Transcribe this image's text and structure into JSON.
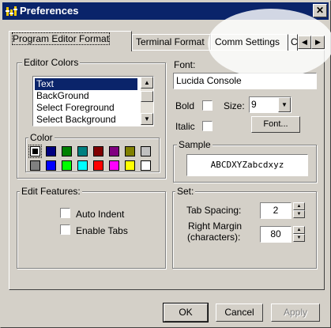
{
  "window": {
    "title": "Preferences",
    "close_glyph": "✕"
  },
  "tabs": [
    {
      "label": "Program Editor Format"
    },
    {
      "label": "Terminal Format"
    },
    {
      "label": "Comm Settings"
    },
    {
      "label": "C"
    }
  ],
  "tab_scroll": {
    "left_glyph": "◀",
    "right_glyph": "▶"
  },
  "editor_colors": {
    "group_label": "Editor Colors",
    "items": [
      "Text",
      "BackGround",
      "Select Foreground",
      "Select Background"
    ],
    "selected": "Text",
    "color_label": "Color",
    "palette_row1": [
      "#000000",
      "#000080",
      "#008000",
      "#008080",
      "#800000",
      "#800080",
      "#808000",
      "#c0c0c0"
    ],
    "palette_row2": [
      "#808080",
      "#0000ff",
      "#00ff00",
      "#00ffff",
      "#ff0000",
      "#ff00ff",
      "#ffff00",
      "#ffffff"
    ],
    "selected_color": "#000000"
  },
  "font": {
    "label": "Font:",
    "value": "Lucida Console",
    "bold_label": "Bold",
    "bold_checked": false,
    "italic_label": "Italic",
    "italic_checked": false,
    "size_label": "Size:",
    "size_value": "9",
    "font_button": "Font..."
  },
  "sample": {
    "label": "Sample",
    "text": "ABCDXYZabcdxyz"
  },
  "edit_features": {
    "label": "Edit Features:",
    "auto_indent_label": "Auto Indent",
    "auto_indent_checked": false,
    "enable_tabs_label": "Enable Tabs",
    "enable_tabs_checked": false
  },
  "set": {
    "label": "Set:",
    "tab_spacing_label": "Tab Spacing:",
    "tab_spacing_value": "2",
    "right_margin_label_1": "Right Margin",
    "right_margin_label_2": "(characters):",
    "right_margin_value": "80"
  },
  "buttons": {
    "ok": "OK",
    "cancel": "Cancel",
    "apply": "Apply"
  },
  "icons": {
    "title_icon": "preferences-icon",
    "dropdown": "chevron-down-icon",
    "spin_up": "spin-up-icon",
    "spin_down": "spin-down-icon"
  }
}
